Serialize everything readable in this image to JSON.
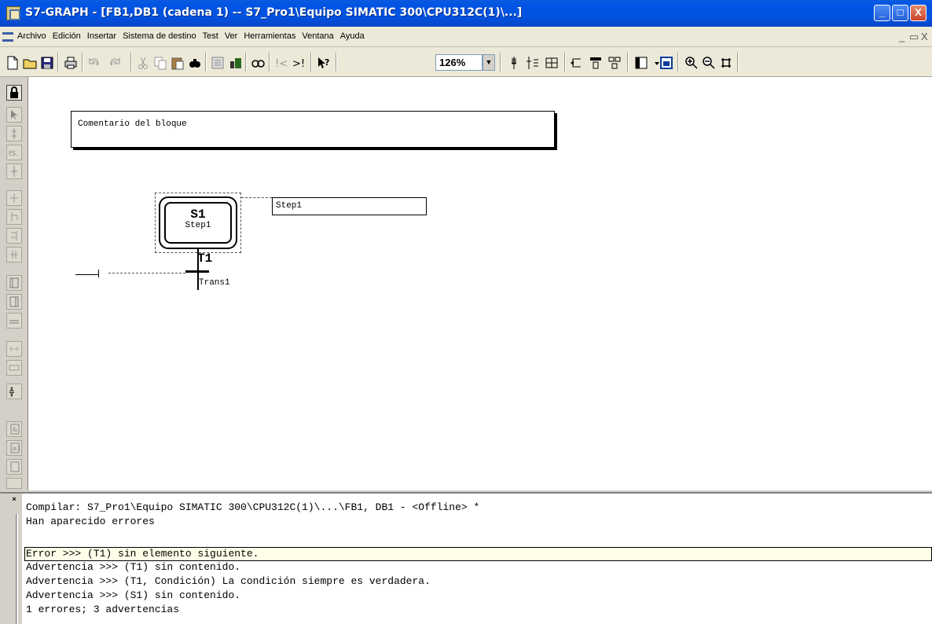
{
  "window": {
    "title": "S7-GRAPH - [FB1,DB1 (cadena 1) -- S7_Pro1\\Equipo SIMATIC 300\\CPU312C(1)\\...]",
    "btn_min": "_",
    "btn_max": "□",
    "btn_close": "X"
  },
  "menu": {
    "items": [
      "Archivo",
      "Edición",
      "Insertar",
      "Sistema de destino",
      "Test",
      "Ver",
      "Herramientas",
      "Ventana",
      "Ayuda"
    ],
    "mdi_min": "_",
    "mdi_restore": "▭",
    "mdi_close": "X"
  },
  "toolbar": {
    "zoom": "126%"
  },
  "diagram": {
    "block_comment": "Comentario del bloque",
    "step_number": "S1",
    "step_name": "Step1",
    "step_action_label": "Step1",
    "transition_number": "T1",
    "transition_name": "Trans1"
  },
  "output": {
    "lines": [
      "Compilar: S7_Pro1\\Equipo SIMATIC 300\\CPU312C(1)\\...\\FB1, DB1 - <Offline> *",
      "Han aparecido errores",
      "Error >>> (T1)  sin elemento siguiente.",
      "Advertencia >>> (T1)  sin contenido.",
      "Advertencia >>> (T1, Condición)  La condición siempre es verdadera.",
      "Advertencia >>> (S1)  sin contenido.",
      "1 errores; 3 advertencias"
    ]
  }
}
